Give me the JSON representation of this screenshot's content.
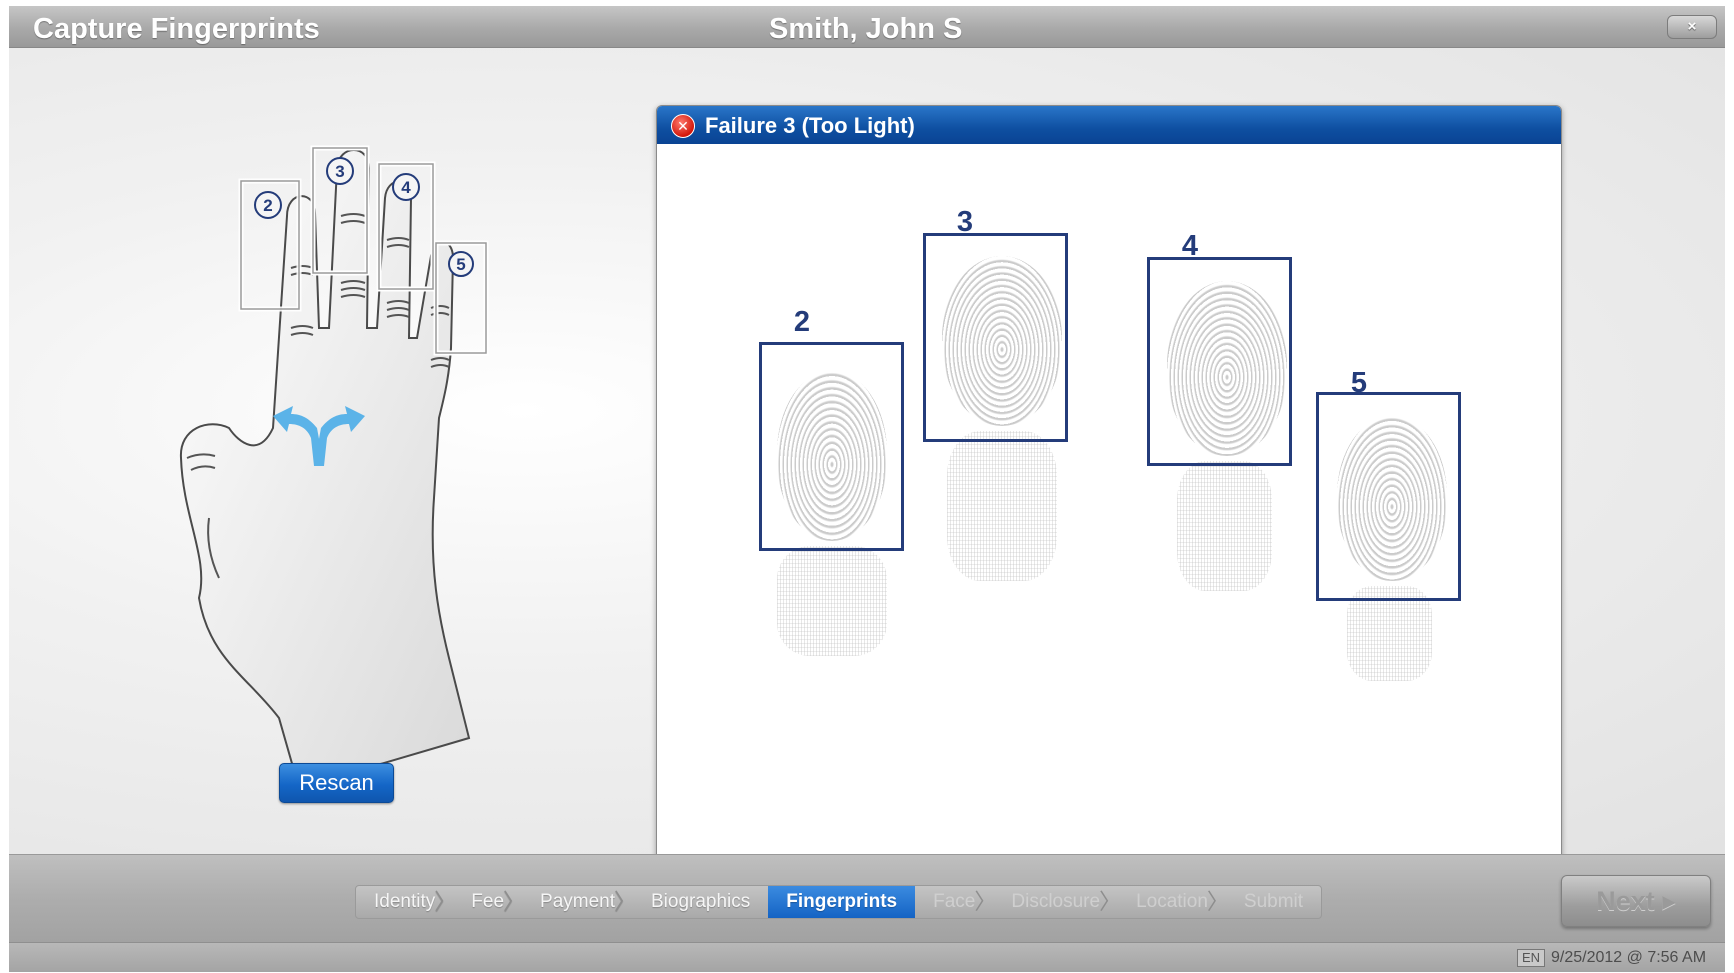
{
  "header": {
    "title": "Capture Fingerprints",
    "person_name": "Smith, John S",
    "close_label": "×"
  },
  "hand": {
    "finger_labels": [
      "2",
      "3",
      "4",
      "5"
    ]
  },
  "rescan_label": "Rescan",
  "panel": {
    "title": "Failure 3 (Too Light)",
    "error_icon": "close-x-icon",
    "prints": [
      {
        "label": "2"
      },
      {
        "label": "3"
      },
      {
        "label": "4"
      },
      {
        "label": "5"
      }
    ]
  },
  "steps": {
    "items": [
      {
        "label": "Identity",
        "state": "done"
      },
      {
        "label": "Fee",
        "state": "done"
      },
      {
        "label": "Payment",
        "state": "done"
      },
      {
        "label": "Biographics",
        "state": "done"
      },
      {
        "label": "Fingerprints",
        "state": "active"
      },
      {
        "label": "Face",
        "state": "todo"
      },
      {
        "label": "Disclosure",
        "state": "todo"
      },
      {
        "label": "Location",
        "state": "todo"
      },
      {
        "label": "Submit",
        "state": "todo"
      }
    ]
  },
  "next_label": "Next ▸",
  "status": {
    "language": "EN",
    "datetime": "9/25/2012 @ 7:56 AM"
  },
  "colors": {
    "accent_blue": "#1466c7",
    "box_navy": "#243c7a",
    "error_red": "#d3170a"
  }
}
